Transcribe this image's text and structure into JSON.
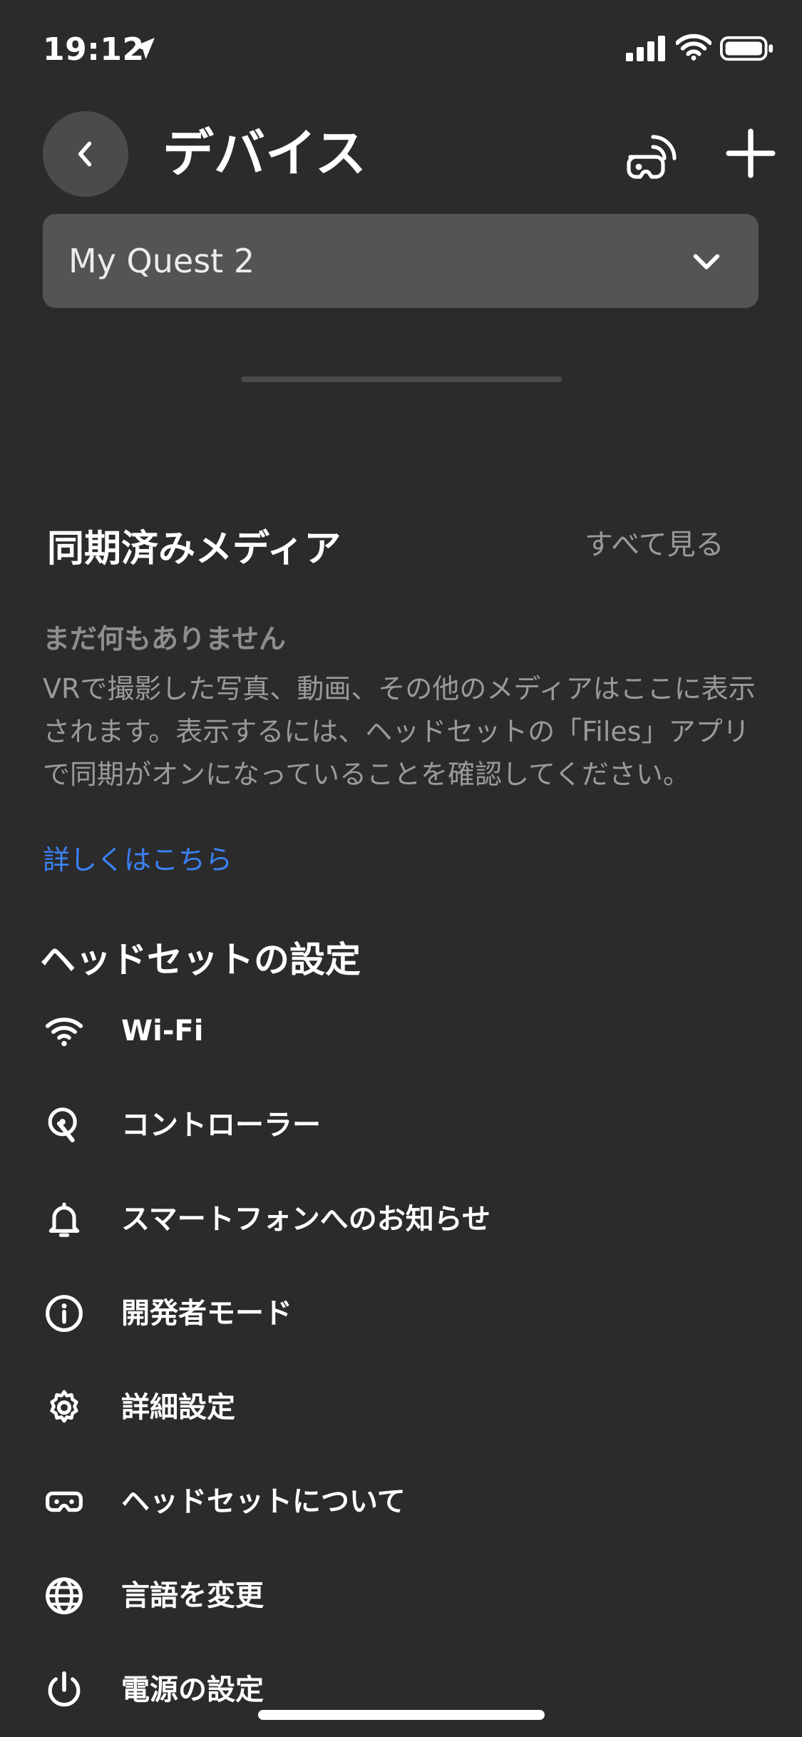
{
  "status": {
    "time": "19:12",
    "icons": [
      "location-arrow-icon",
      "signal-bars-icon",
      "wifi-icon",
      "battery-icon"
    ]
  },
  "header": {
    "title": "デバイス",
    "back_icon": "chevron-left-icon",
    "cast_icon": "headset-cast-icon",
    "add_icon": "plus-icon"
  },
  "device_select": {
    "value": "My Quest 2",
    "icon": "chevron-down-icon"
  },
  "synced_media": {
    "title": "同期済みメディア",
    "see_all": "すべて見る",
    "empty_title": "まだ何もありません",
    "empty_body": "VRで撮影した写真、動画、その他のメディアはここに表示されます。表示するには、ヘッドセットの「Files」アプリで同期がオンになっていることを確認してください。",
    "learn_more": "詳しくはこちら"
  },
  "headset_settings": {
    "title": "ヘッドセットの設定",
    "items": [
      {
        "label": "Wi-Fi",
        "icon": "wifi-icon"
      },
      {
        "label": "コントローラー",
        "icon": "controller-icon"
      },
      {
        "label": "スマートフォンへのお知らせ",
        "icon": "bell-icon"
      },
      {
        "label": "開発者モード",
        "icon": "info-icon"
      },
      {
        "label": "詳細設定",
        "icon": "gear-icon"
      },
      {
        "label": "ヘッドセットについて",
        "icon": "headset-icon"
      },
      {
        "label": "言語を変更",
        "icon": "globe-icon"
      },
      {
        "label": "電源の設定",
        "icon": "power-icon"
      }
    ]
  },
  "colors": {
    "background": "#2b2b2c",
    "card": "#545456",
    "link": "#3b82f6",
    "muted_text": "#9a9a9c"
  }
}
